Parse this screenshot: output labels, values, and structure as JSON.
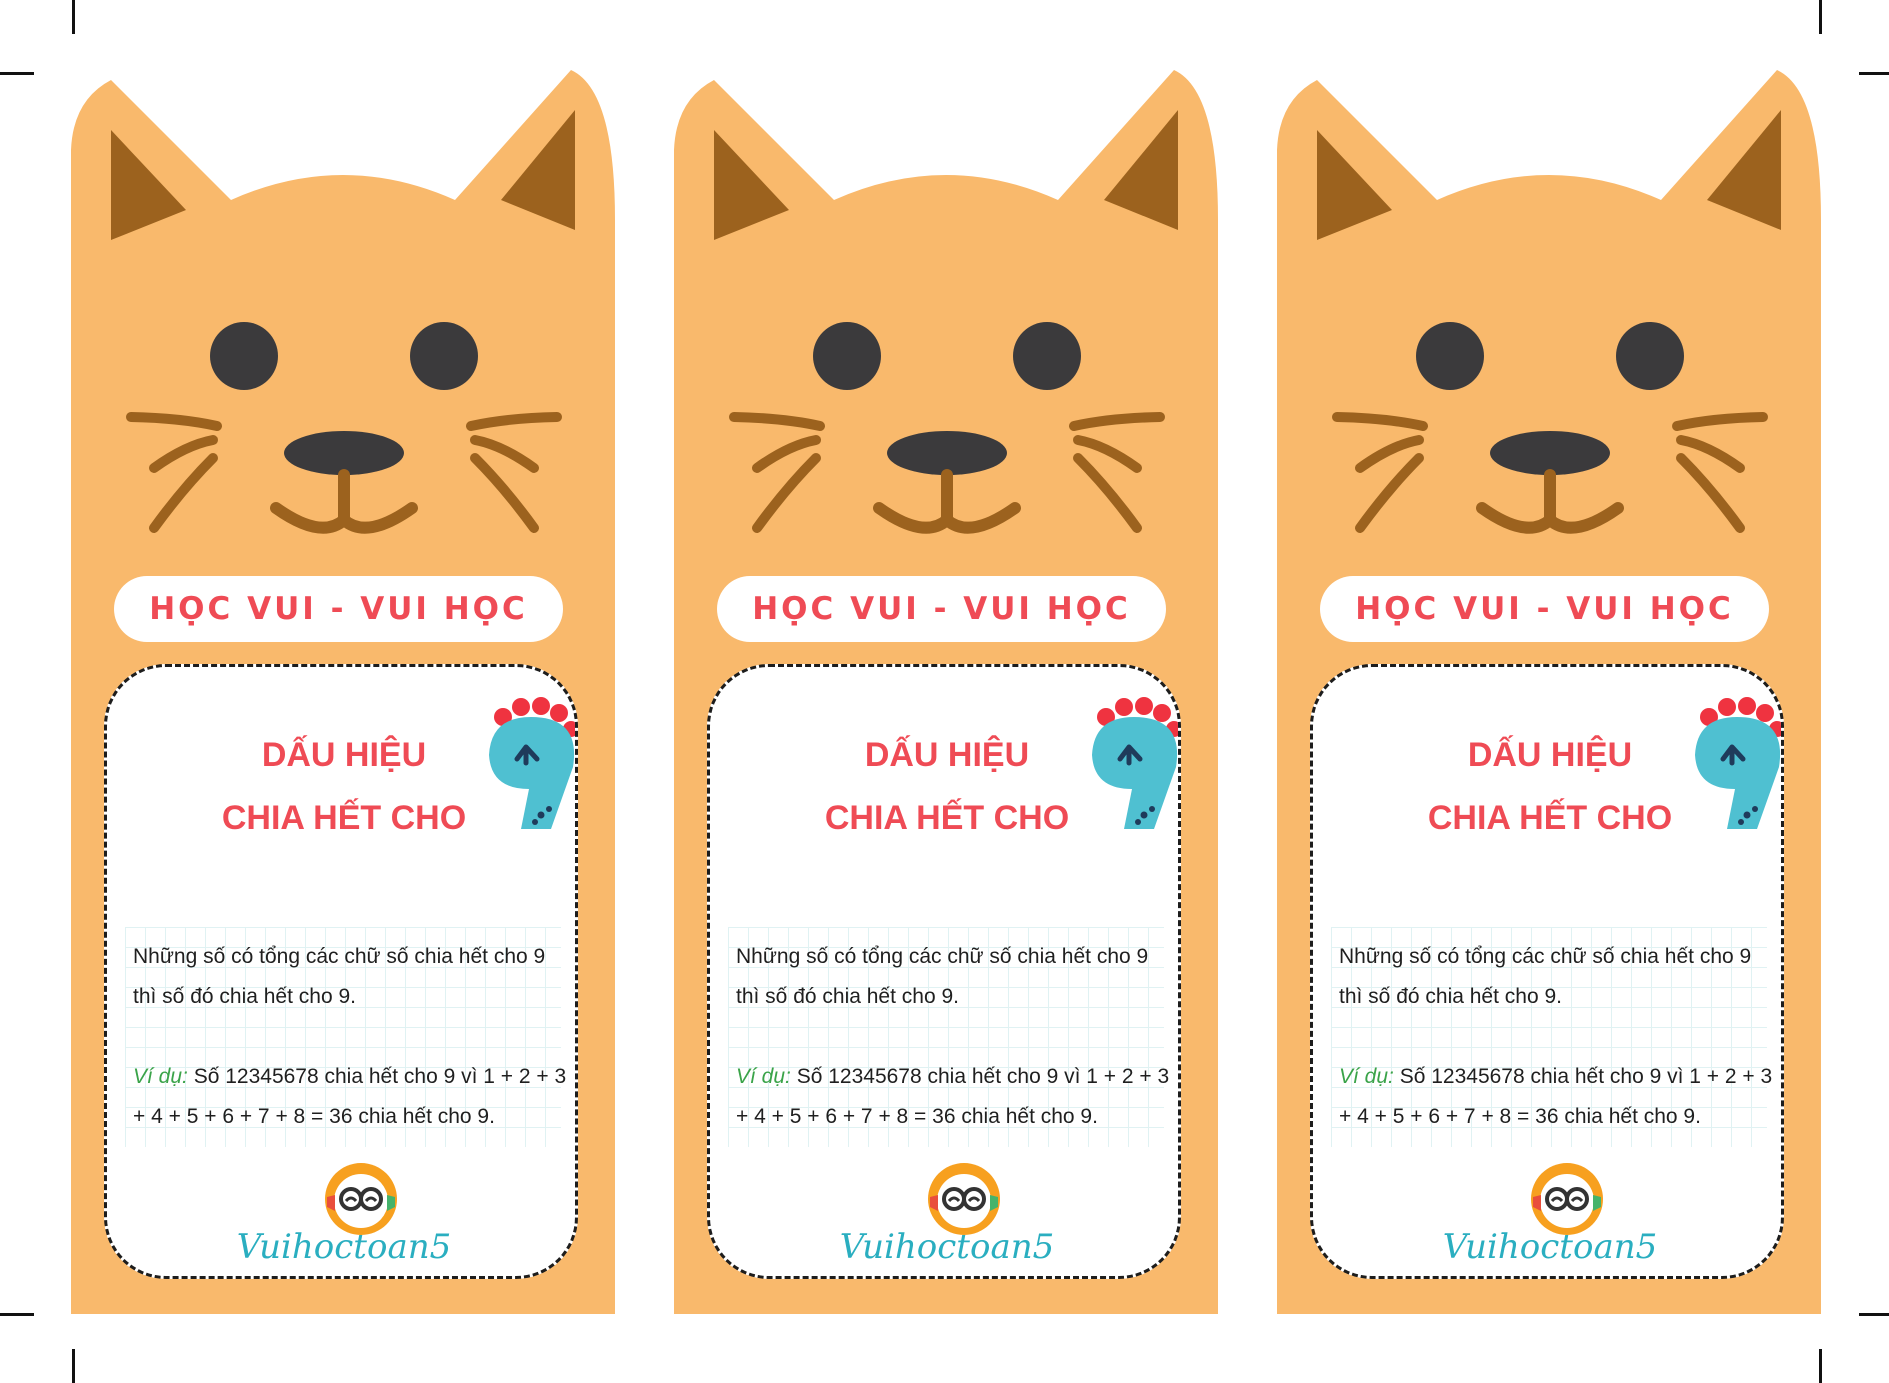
{
  "bookmarks": [
    {
      "banner": "HỌC VUI - VUI HỌC",
      "title_line1": "DẤU HIỆU",
      "title_line2": "CHIA HẾT CHO",
      "big_number": "9",
      "rule": "Những số có tổng các chữ số chia hết cho 9 thì số đó chia hết cho 9.",
      "example_label": "Ví dụ:",
      "example": " Số 12345678 chia hết cho 9 vì 1 + 2 + 3 + 4 + 5 + 6 + 7 + 8 = 36 chia hết cho 9.",
      "logo": "Vuihoctoan5"
    },
    {
      "banner": "HỌC VUI - VUI HỌC",
      "title_line1": "DẤU HIỆU",
      "title_line2": "CHIA HẾT CHO",
      "big_number": "9",
      "rule": "Những số có tổng các chữ số chia hết cho 9 thì số đó chia hết cho 9.",
      "example_label": "Ví dụ:",
      "example": " Số 12345678 chia hết cho 9 vì 1 + 2 + 3 + 4 + 5 + 6 + 7 + 8 = 36 chia hết cho 9.",
      "logo": "Vuihoctoan5"
    },
    {
      "banner": "HỌC VUI - VUI HỌC",
      "title_line1": "DẤU HIỆU",
      "title_line2": "CHIA HẾT CHO",
      "big_number": "9",
      "rule": "Những số có tổng các chữ số chia hết cho 9 thì số đó chia hết cho 9.",
      "example_label": "Ví dụ:",
      "example": " Số 12345678 chia hết cho 9 vì 1 + 2 + 3 + 4 + 5 + 6 + 7 + 8 = 36 chia hết cho 9.",
      "logo": "Vuihoctoan5"
    }
  ],
  "colors": {
    "cat_body": "#f9b96c",
    "cat_ear_inner": "#9c621e",
    "whisker": "#9c621e",
    "eye": "#3b3a3c",
    "banner_text": "#ef4b55",
    "title": "#ef4b55",
    "example_label": "#3aa349",
    "number_nine": "#4fc0d1",
    "logo": "#2aaec0"
  },
  "icons": [
    "cat-face-icon",
    "number-nine-dinosaur-icon",
    "owl-logo-icon"
  ]
}
